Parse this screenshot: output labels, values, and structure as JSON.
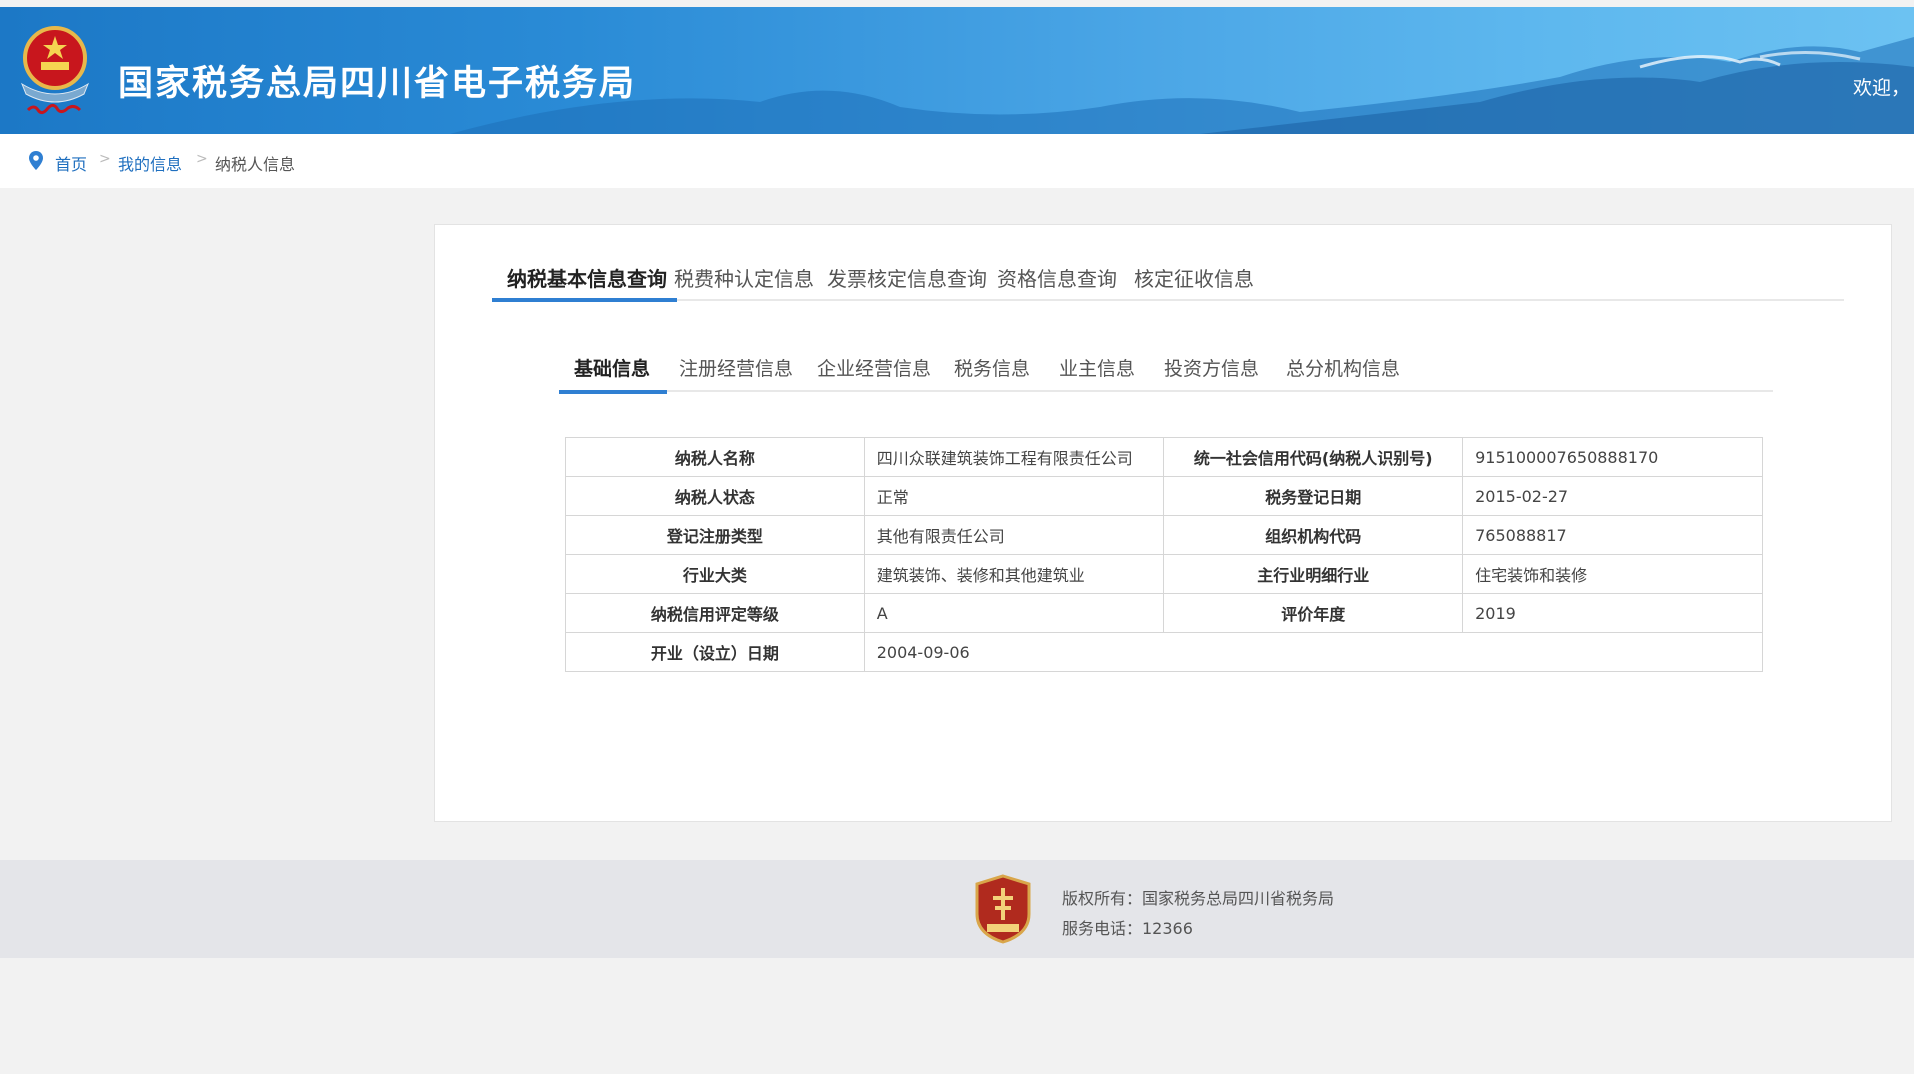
{
  "header": {
    "title": "国家税务总局四川省电子税务局",
    "welcome": "欢迎，"
  },
  "breadcrumb": {
    "items": [
      "首页",
      "我的信息",
      "纳税人信息"
    ],
    "separator": ">"
  },
  "tabs_primary": [
    {
      "label": "纳税基本信息查询",
      "active": true
    },
    {
      "label": "税费种认定信息",
      "active": false
    },
    {
      "label": "发票核定信息查询",
      "active": false
    },
    {
      "label": "资格信息查询",
      "active": false
    },
    {
      "label": "核定征收信息",
      "active": false
    }
  ],
  "tabs_secondary": [
    {
      "label": "基础信息",
      "active": true
    },
    {
      "label": "注册经营信息",
      "active": false
    },
    {
      "label": "企业经营信息",
      "active": false
    },
    {
      "label": "税务信息",
      "active": false
    },
    {
      "label": "业主信息",
      "active": false
    },
    {
      "label": "投资方信息",
      "active": false
    },
    {
      "label": "总分机构信息",
      "active": false
    }
  ],
  "info_table": {
    "rows": [
      {
        "l1": "纳税人名称",
        "v1": "四川众联建筑装饰工程有限责任公司",
        "l2": "统一社会信用代码(纳税人识别号)",
        "v2": "915100007650888170"
      },
      {
        "l1": "纳税人状态",
        "v1": "正常",
        "l2": "税务登记日期",
        "v2": "2015-02-27"
      },
      {
        "l1": "登记注册类型",
        "v1": "其他有限责任公司",
        "l2": "组织机构代码",
        "v2": "765088817"
      },
      {
        "l1": "行业大类",
        "v1": "建筑装饰、装修和其他建筑业",
        "l2": "主行业明细行业",
        "v2": "住宅装饰和装修"
      },
      {
        "l1": "纳税信用评定等级",
        "v1": "A",
        "l2": "评价年度",
        "v2": "2019"
      },
      {
        "l1": "开业（设立）日期",
        "v1": "2004-09-06"
      }
    ]
  },
  "footer": {
    "copyright": "版权所有：国家税务总局四川省税务局",
    "phone": "服务电话：12366"
  },
  "colors": {
    "accent": "#2f7fd2",
    "link": "#1f6fbf",
    "header_blue": "#1c78c6"
  }
}
